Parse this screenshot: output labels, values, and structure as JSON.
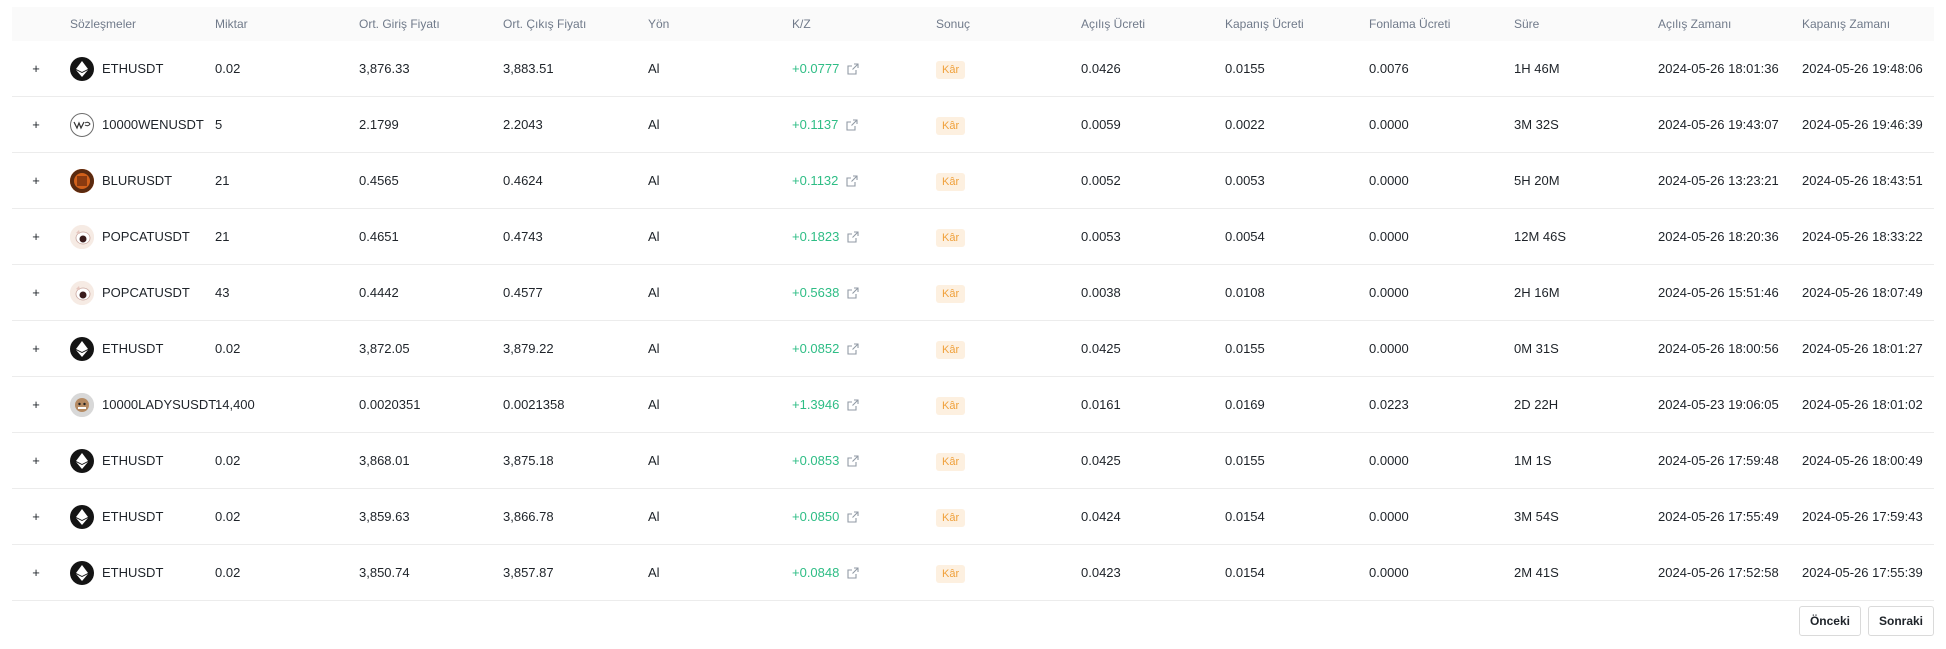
{
  "table": {
    "headers": {
      "contract": "Sözleşmeler",
      "qty": "Miktar",
      "entry": "Ort. Giriş Fiyatı",
      "exit": "Ort. Çıkış Fiyatı",
      "side": "Yön",
      "pnl": "K/Z",
      "result": "Sonuç",
      "openfee": "Açılış Ücreti",
      "closefee": "Kapanış Ücreti",
      "funding": "Fonlama Ücreti",
      "duration": "Süre",
      "opentime": "Açılış Zamanı",
      "closetime": "Kapanış Zamanı"
    },
    "expand_symbol": "+",
    "rows": [
      {
        "icon": "eth",
        "contract": "ETHUSDT",
        "qty": "0.02",
        "entry": "3,876.33",
        "exit": "3,883.51",
        "side": "Al",
        "pnl": "+0.0777",
        "result": "Kâr",
        "openfee": "0.0426",
        "closefee": "0.0155",
        "funding": "0.0076",
        "duration": "1H 46M",
        "opentime": "2024-05-26 18:01:36",
        "closetime": "2024-05-26 19:48:06"
      },
      {
        "icon": "wen",
        "contract": "10000WENUSDT",
        "qty": "5",
        "entry": "2.1799",
        "exit": "2.2043",
        "side": "Al",
        "pnl": "+0.1137",
        "result": "Kâr",
        "openfee": "0.0059",
        "closefee": "0.0022",
        "funding": "0.0000",
        "duration": "3M 32S",
        "opentime": "2024-05-26 19:43:07",
        "closetime": "2024-05-26 19:46:39"
      },
      {
        "icon": "blur",
        "contract": "BLURUSDT",
        "qty": "21",
        "entry": "0.4565",
        "exit": "0.4624",
        "side": "Al",
        "pnl": "+0.1132",
        "result": "Kâr",
        "openfee": "0.0052",
        "closefee": "0.0053",
        "funding": "0.0000",
        "duration": "5H 20M",
        "opentime": "2024-05-26 13:23:21",
        "closetime": "2024-05-26 18:43:51"
      },
      {
        "icon": "popcat",
        "contract": "POPCATUSDT",
        "qty": "21",
        "entry": "0.4651",
        "exit": "0.4743",
        "side": "Al",
        "pnl": "+0.1823",
        "result": "Kâr",
        "openfee": "0.0053",
        "closefee": "0.0054",
        "funding": "0.0000",
        "duration": "12M 46S",
        "opentime": "2024-05-26 18:20:36",
        "closetime": "2024-05-26 18:33:22"
      },
      {
        "icon": "popcat",
        "contract": "POPCATUSDT",
        "qty": "43",
        "entry": "0.4442",
        "exit": "0.4577",
        "side": "Al",
        "pnl": "+0.5638",
        "result": "Kâr",
        "openfee": "0.0038",
        "closefee": "0.0108",
        "funding": "0.0000",
        "duration": "2H 16M",
        "opentime": "2024-05-26 15:51:46",
        "closetime": "2024-05-26 18:07:49"
      },
      {
        "icon": "eth",
        "contract": "ETHUSDT",
        "qty": "0.02",
        "entry": "3,872.05",
        "exit": "3,879.22",
        "side": "Al",
        "pnl": "+0.0852",
        "result": "Kâr",
        "openfee": "0.0425",
        "closefee": "0.0155",
        "funding": "0.0000",
        "duration": "0M 31S",
        "opentime": "2024-05-26 18:00:56",
        "closetime": "2024-05-26 18:01:27"
      },
      {
        "icon": "ladys",
        "contract": "10000LADYSUSDT",
        "qty": "14,400",
        "entry": "0.0020351",
        "exit": "0.0021358",
        "side": "Al",
        "pnl": "+1.3946",
        "result": "Kâr",
        "openfee": "0.0161",
        "closefee": "0.0169",
        "funding": "0.0223",
        "duration": "2D 22H",
        "opentime": "2024-05-23 19:06:05",
        "closetime": "2024-05-26 18:01:02"
      },
      {
        "icon": "eth",
        "contract": "ETHUSDT",
        "qty": "0.02",
        "entry": "3,868.01",
        "exit": "3,875.18",
        "side": "Al",
        "pnl": "+0.0853",
        "result": "Kâr",
        "openfee": "0.0425",
        "closefee": "0.0155",
        "funding": "0.0000",
        "duration": "1M 1S",
        "opentime": "2024-05-26 17:59:48",
        "closetime": "2024-05-26 18:00:49"
      },
      {
        "icon": "eth",
        "contract": "ETHUSDT",
        "qty": "0.02",
        "entry": "3,859.63",
        "exit": "3,866.78",
        "side": "Al",
        "pnl": "+0.0850",
        "result": "Kâr",
        "openfee": "0.0424",
        "closefee": "0.0154",
        "funding": "0.0000",
        "duration": "3M 54S",
        "opentime": "2024-05-26 17:55:49",
        "closetime": "2024-05-26 17:59:43"
      },
      {
        "icon": "eth",
        "contract": "ETHUSDT",
        "qty": "0.02",
        "entry": "3,850.74",
        "exit": "3,857.87",
        "side": "Al",
        "pnl": "+0.0848",
        "result": "Kâr",
        "openfee": "0.0423",
        "closefee": "0.0154",
        "funding": "0.0000",
        "duration": "2M 41S",
        "opentime": "2024-05-26 17:52:58",
        "closetime": "2024-05-26 17:55:39"
      }
    ]
  },
  "pagination": {
    "prev_label": "Önceki",
    "next_label": "Sonraki"
  },
  "colors": {
    "profit_green": "#2ebd85",
    "badge_text": "#f0a13c",
    "badge_bg": "#fdf0e0",
    "header_text": "#707a8a"
  },
  "icons": {
    "eth": "ethereum-icon",
    "wen": "wen-icon",
    "blur": "blur-icon",
    "popcat": "popcat-icon",
    "ladys": "ladys-icon",
    "share": "external-link-icon"
  }
}
